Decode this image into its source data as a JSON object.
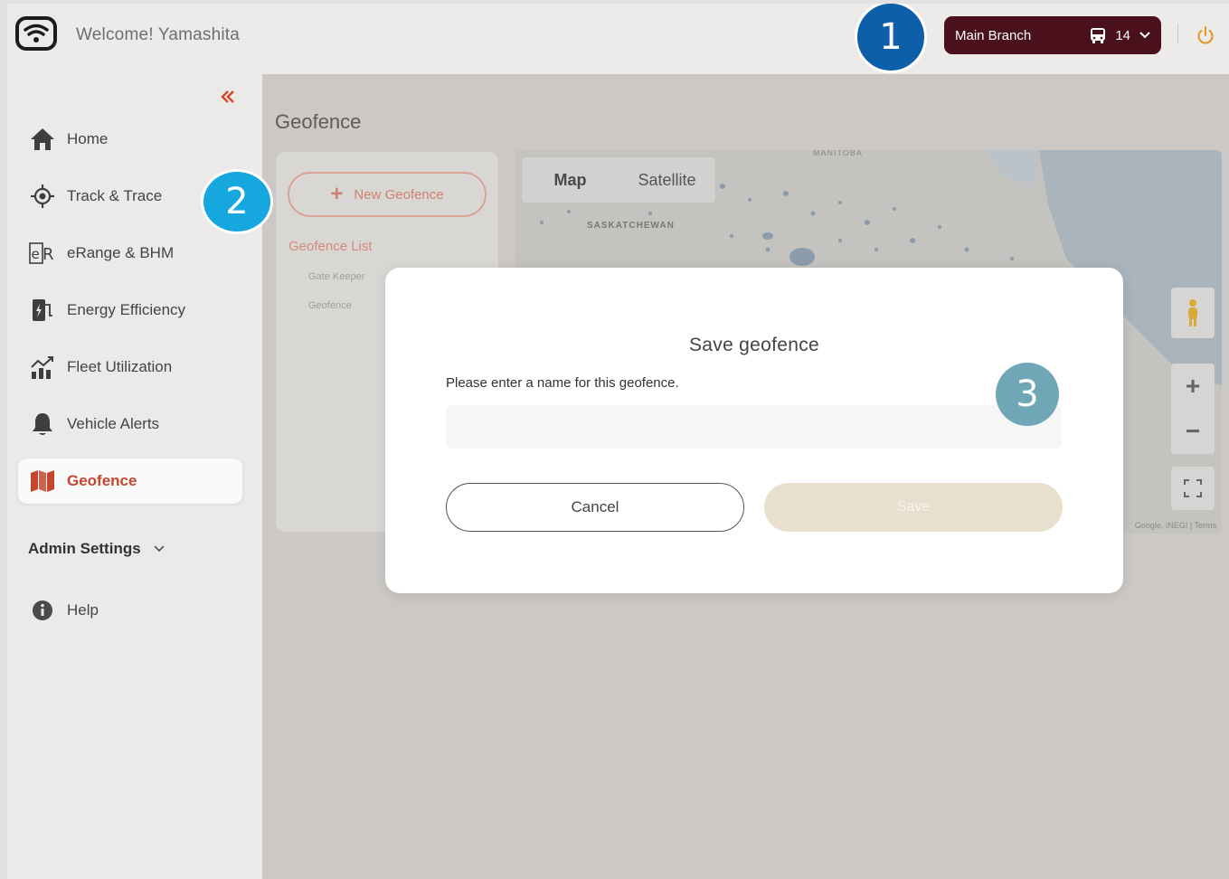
{
  "header": {
    "welcome": "Welcome! Yamashita",
    "branch_name": "Main Branch",
    "vehicle_count": "14",
    "icons": {
      "logo": "wifi-logo-icon",
      "bus": "bus-icon",
      "chevron": "chevron-down-icon",
      "power": "power-icon"
    }
  },
  "sidebar": {
    "collapse_icon": "double-chevron-left-icon",
    "items": [
      {
        "label": "Home",
        "icon": "home-icon"
      },
      {
        "label": "Track & Trace",
        "icon": "crosshair-icon"
      },
      {
        "label": "eRange & BHM",
        "icon": "erange-icon"
      },
      {
        "label": "Energy Efficiency",
        "icon": "charger-icon"
      },
      {
        "label": "Fleet Utilization",
        "icon": "chart-icon"
      },
      {
        "label": "Vehicle Alerts",
        "icon": "bell-icon"
      },
      {
        "label": "Geofence",
        "icon": "map-icon",
        "active": true
      }
    ],
    "admin_settings": "Admin Settings",
    "help": "Help"
  },
  "main": {
    "title": "Geofence",
    "new_geofence": "New Geofence",
    "list_label": "Geofence List",
    "list_entries": [
      "Gate Keeper",
      "Geofence"
    ],
    "map": {
      "type_options": [
        "Map",
        "Satellite"
      ],
      "selected_type": "Map",
      "region_labels": [
        "MANITOBA",
        "SASKATCHEWAN"
      ],
      "terms": "Google, INEGI | Terms"
    }
  },
  "modal": {
    "title": "Save geofence",
    "prompt": "Please enter a name for this geofence.",
    "input_value": "",
    "input_placeholder": "",
    "cancel": "Cancel",
    "save": "Save"
  },
  "callouts": [
    "1",
    "2",
    "3"
  ],
  "colors": {
    "brand_dark": "#4a111c",
    "accent": "#c4462e",
    "callout_1": "#0d5fa9",
    "callout_2": "#16a7df",
    "callout_3": "#6fa7b6",
    "save_disabled": "#e8dfcf"
  }
}
